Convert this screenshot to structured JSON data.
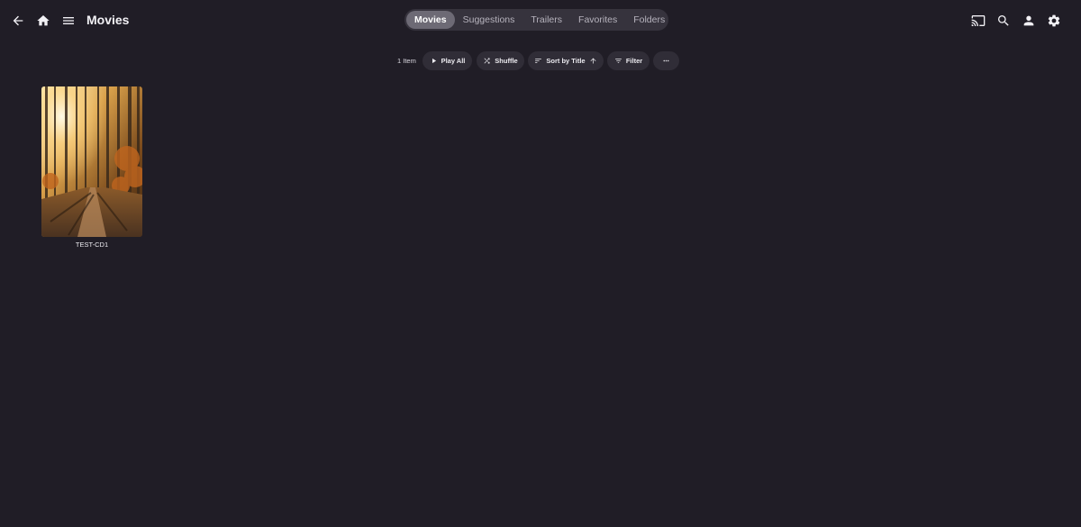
{
  "header": {
    "title": "Movies",
    "left_icons": [
      "back-arrow-icon",
      "home-icon",
      "menu-icon"
    ],
    "right_icons": [
      "cast-icon",
      "search-icon",
      "user-icon",
      "settings-gear-icon"
    ]
  },
  "tabs": [
    {
      "label": "Movies",
      "active": true
    },
    {
      "label": "Suggestions",
      "active": false
    },
    {
      "label": "Trailers",
      "active": false
    },
    {
      "label": "Favorites",
      "active": false
    },
    {
      "label": "Folders",
      "active": false
    }
  ],
  "toolbar": {
    "item_count": "1 Item",
    "play_all": "Play All",
    "shuffle": "Shuffle",
    "sort": "Sort by Title",
    "filter": "Filter",
    "more_icon": "more-horizontal-icon"
  },
  "items": [
    {
      "title": "TEST-CD1"
    }
  ],
  "colors": {
    "background": "#201d26",
    "tab_bar": "#36333d",
    "tab_active": "#6d6a75",
    "button": "#302d37",
    "text": "#f2f1f5"
  }
}
